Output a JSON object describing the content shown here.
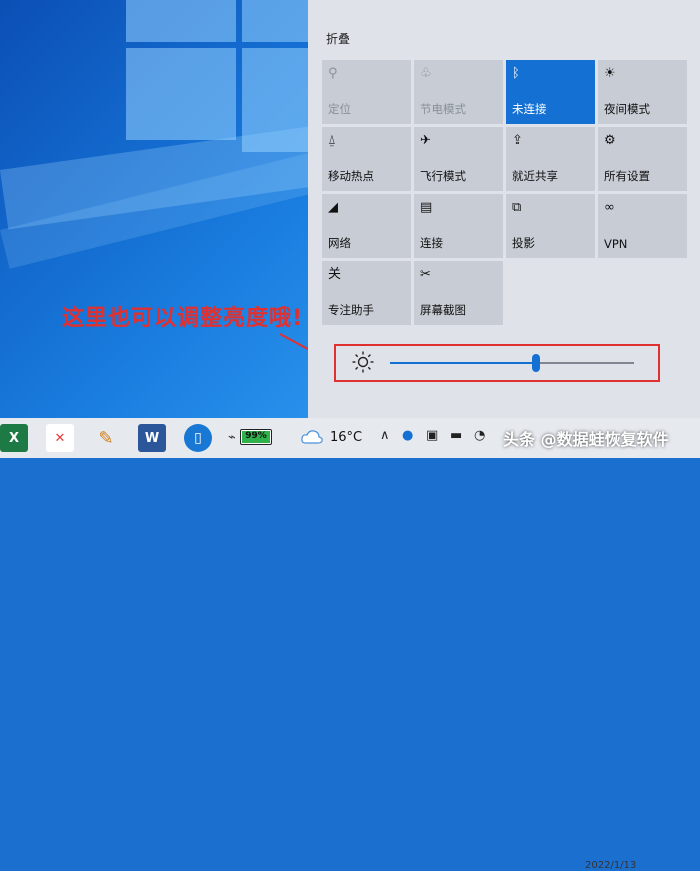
{
  "action_center": {
    "collapse_label": "折叠",
    "tiles": [
      {
        "label": "定位",
        "icon": "location-icon",
        "state": "dim"
      },
      {
        "label": "节电模式",
        "icon": "battery-saver-icon",
        "state": "dim"
      },
      {
        "label": "未连接",
        "icon": "bluetooth-icon",
        "state": "active"
      },
      {
        "label": "夜间模式",
        "icon": "night-light-icon",
        "state": "normal"
      },
      {
        "label": "移动热点",
        "icon": "hotspot-icon",
        "state": "normal"
      },
      {
        "label": "飞行模式",
        "icon": "airplane-icon",
        "state": "normal"
      },
      {
        "label": "就近共享",
        "icon": "nearby-share-icon",
        "state": "normal"
      },
      {
        "label": "所有设置",
        "icon": "gear-icon",
        "state": "normal"
      },
      {
        "label": "网络",
        "icon": "network-icon",
        "state": "normal"
      },
      {
        "label": "连接",
        "icon": "connect-icon",
        "state": "normal"
      },
      {
        "label": "投影",
        "icon": "project-icon",
        "state": "normal"
      },
      {
        "label": "VPN",
        "icon": "vpn-icon",
        "state": "normal"
      },
      {
        "label": "专注助手",
        "icon": "focus-assist-icon",
        "state": "normal",
        "icon_text": "关"
      },
      {
        "label": "屏幕截图",
        "icon": "screen-snip-icon",
        "state": "normal"
      }
    ],
    "brightness": {
      "level": 0.6
    }
  },
  "annotation": "这里也可以调整亮度哦!",
  "taskbar": {
    "battery_percent": "99%",
    "battery_level": 0.99,
    "temperature": "16°C",
    "date": "2022/1/13",
    "apps": [
      "excel-icon",
      "xmind-icon",
      "paint-icon",
      "word-icon",
      "tablet-icon"
    ]
  },
  "watermark": "头条 @数据蛙恢复软件",
  "colors": {
    "accent": "#1570d4",
    "annotation": "#e03030"
  }
}
